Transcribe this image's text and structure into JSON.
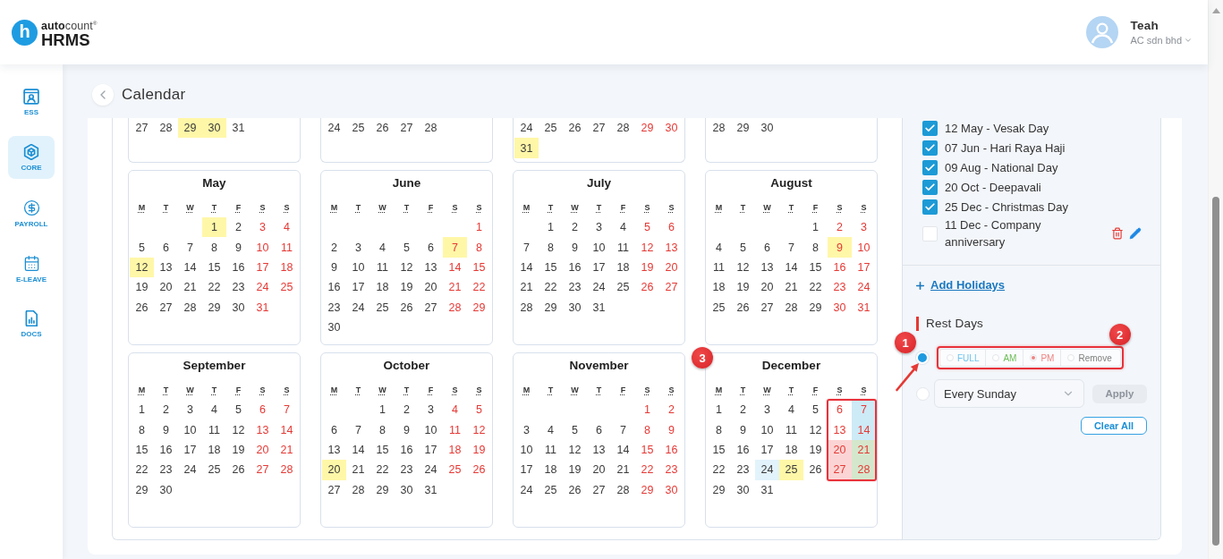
{
  "header": {
    "logo": {
      "mark": "h",
      "brand": "**auto**count$^{®}$",
      "product": "HRMS"
    },
    "user": {
      "name": "Teah",
      "company": "AC sdn bhd"
    }
  },
  "sidebar": {
    "items": [
      {
        "label": "ESS",
        "selected": false
      },
      {
        "label": "CORE",
        "selected": true
      },
      {
        "label": "PAYROLL",
        "selected": false
      },
      {
        "label": "E-LEAVE",
        "selected": false
      },
      {
        "label": "DOCS",
        "selected": false
      }
    ]
  },
  "page": {
    "title": "Calendar"
  },
  "calendar": {
    "months": [
      {
        "weeks": [
          [
            {
              "day": "27",
              "weekend": false
            },
            {
              "day": "28",
              "weekend": false
            },
            {
              "day": "29",
              "weekend": false,
              "color": "#fff7a8"
            },
            {
              "day": "30",
              "weekend": false,
              "color": "#fff7a8"
            },
            {
              "day": "31",
              "weekend": false
            }
          ]
        ]
      },
      {
        "weeks": [
          [
            {
              "day": "24",
              "weekend": false
            },
            {
              "day": "25",
              "weekend": false
            },
            {
              "day": "26",
              "weekend": false
            },
            {
              "day": "27",
              "weekend": false
            },
            {
              "day": "28",
              "weekend": false
            }
          ]
        ]
      },
      {
        "weeks": [
          [
            {
              "day": "24",
              "weekend": false
            },
            {
              "day": "25",
              "weekend": false
            },
            {
              "day": "26",
              "weekend": false
            },
            {
              "day": "27",
              "weekend": false
            },
            {
              "day": "28",
              "weekend": false
            },
            {
              "day": "29",
              "weekend": true
            },
            {
              "day": "30",
              "weekend": true
            }
          ],
          [
            {
              "day": "31",
              "weekend": false,
              "color": "#fff7a8"
            }
          ]
        ]
      },
      {
        "weeks": [
          [
            {
              "day": "28",
              "weekend": false
            },
            {
              "day": "29",
              "weekend": false
            },
            {
              "day": "30",
              "weekend": false
            }
          ]
        ]
      },
      {
        "name": "May",
        "weekdays": [
          "M",
          "T",
          "W",
          "T",
          "F",
          "S",
          "S"
        ],
        "weeks": [
          [
            {
              "day": "1",
              "weekend": false,
              "color": "#fff7a8"
            },
            {
              "day": "2",
              "weekend": false
            },
            {
              "day": "3",
              "weekend": true
            },
            {
              "day": "4",
              "weekend": true
            }
          ],
          [
            {
              "day": "5",
              "weekend": false
            },
            {
              "day": "6",
              "weekend": false
            },
            {
              "day": "7",
              "weekend": false
            },
            {
              "day": "8",
              "weekend": false
            },
            {
              "day": "9",
              "weekend": false
            },
            {
              "day": "10",
              "weekend": true
            },
            {
              "day": "11",
              "weekend": true
            }
          ],
          [
            {
              "day": "12",
              "weekend": false,
              "color": "#fff7a8"
            },
            {
              "day": "13",
              "weekend": false
            },
            {
              "day": "14",
              "weekend": false
            },
            {
              "day": "15",
              "weekend": false
            },
            {
              "day": "16",
              "weekend": false
            },
            {
              "day": "17",
              "weekend": true
            },
            {
              "day": "18",
              "weekend": true
            }
          ],
          [
            {
              "day": "19",
              "weekend": false
            },
            {
              "day": "20",
              "weekend": false
            },
            {
              "day": "21",
              "weekend": false
            },
            {
              "day": "22",
              "weekend": false
            },
            {
              "day": "23",
              "weekend": false
            },
            {
              "day": "24",
              "weekend": true
            },
            {
              "day": "25",
              "weekend": true
            }
          ],
          [
            {
              "day": "26",
              "weekend": false
            },
            {
              "day": "27",
              "weekend": false
            },
            {
              "day": "28",
              "weekend": false
            },
            {
              "day": "29",
              "weekend": false
            },
            {
              "day": "30",
              "weekend": false
            },
            {
              "day": "31",
              "weekend": true
            }
          ]
        ]
      },
      {
        "name": "June",
        "weekdays": [
          "M",
          "T",
          "W",
          "T",
          "F",
          "S",
          "S"
        ],
        "weeks": [
          [
            {
              "day": "1",
              "weekend": true
            }
          ],
          [
            {
              "day": "2",
              "weekend": false
            },
            {
              "day": "3",
              "weekend": false
            },
            {
              "day": "4",
              "weekend": false
            },
            {
              "day": "5",
              "weekend": false
            },
            {
              "day": "6",
              "weekend": false
            },
            {
              "day": "7",
              "weekend": true,
              "color": "#fff7a8"
            },
            {
              "day": "8",
              "weekend": true
            }
          ],
          [
            {
              "day": "9",
              "weekend": false
            },
            {
              "day": "10",
              "weekend": false
            },
            {
              "day": "11",
              "weekend": false
            },
            {
              "day": "12",
              "weekend": false
            },
            {
              "day": "13",
              "weekend": false
            },
            {
              "day": "14",
              "weekend": true
            },
            {
              "day": "15",
              "weekend": true
            }
          ],
          [
            {
              "day": "16",
              "weekend": false
            },
            {
              "day": "17",
              "weekend": false
            },
            {
              "day": "18",
              "weekend": false
            },
            {
              "day": "19",
              "weekend": false
            },
            {
              "day": "20",
              "weekend": false
            },
            {
              "day": "21",
              "weekend": true
            },
            {
              "day": "22",
              "weekend": true
            }
          ],
          [
            {
              "day": "23",
              "weekend": false
            },
            {
              "day": "24",
              "weekend": false
            },
            {
              "day": "25",
              "weekend": false
            },
            {
              "day": "26",
              "weekend": false
            },
            {
              "day": "27",
              "weekend": false
            },
            {
              "day": "28",
              "weekend": true
            },
            {
              "day": "29",
              "weekend": true
            }
          ],
          [
            {
              "day": "30",
              "weekend": false
            }
          ]
        ]
      },
      {
        "name": "July",
        "weekdays": [
          "M",
          "T",
          "W",
          "T",
          "F",
          "S",
          "S"
        ],
        "weeks": [
          [
            {
              "day": "1",
              "weekend": false
            },
            {
              "day": "2",
              "weekend": false
            },
            {
              "day": "3",
              "weekend": false
            },
            {
              "day": "4",
              "weekend": false
            },
            {
              "day": "5",
              "weekend": true
            },
            {
              "day": "6",
              "weekend": true
            }
          ],
          [
            {
              "day": "7",
              "weekend": false
            },
            {
              "day": "8",
              "weekend": false
            },
            {
              "day": "9",
              "weekend": false
            },
            {
              "day": "10",
              "weekend": false
            },
            {
              "day": "11",
              "weekend": false
            },
            {
              "day": "12",
              "weekend": true
            },
            {
              "day": "13",
              "weekend": true
            }
          ],
          [
            {
              "day": "14",
              "weekend": false
            },
            {
              "day": "15",
              "weekend": false
            },
            {
              "day": "16",
              "weekend": false
            },
            {
              "day": "17",
              "weekend": false
            },
            {
              "day": "18",
              "weekend": false
            },
            {
              "day": "19",
              "weekend": true
            },
            {
              "day": "20",
              "weekend": true
            }
          ],
          [
            {
              "day": "21",
              "weekend": false
            },
            {
              "day": "22",
              "weekend": false
            },
            {
              "day": "23",
              "weekend": false
            },
            {
              "day": "24",
              "weekend": false
            },
            {
              "day": "25",
              "weekend": false
            },
            {
              "day": "26",
              "weekend": true
            },
            {
              "day": "27",
              "weekend": true
            }
          ],
          [
            {
              "day": "28",
              "weekend": false
            },
            {
              "day": "29",
              "weekend": false
            },
            {
              "day": "30",
              "weekend": false
            },
            {
              "day": "31",
              "weekend": false
            }
          ]
        ]
      },
      {
        "name": "August",
        "weekdays": [
          "M",
          "T",
          "W",
          "T",
          "F",
          "S",
          "S"
        ],
        "weeks": [
          [
            {
              "day": "1",
              "weekend": false
            },
            {
              "day": "2",
              "weekend": true
            },
            {
              "day": "3",
              "weekend": true
            }
          ],
          [
            {
              "day": "4",
              "weekend": false
            },
            {
              "day": "5",
              "weekend": false
            },
            {
              "day": "6",
              "weekend": false
            },
            {
              "day": "7",
              "weekend": false
            },
            {
              "day": "8",
              "weekend": false
            },
            {
              "day": "9",
              "weekend": true,
              "color": "#fff7a8"
            },
            {
              "day": "10",
              "weekend": true
            }
          ],
          [
            {
              "day": "11",
              "weekend": false
            },
            {
              "day": "12",
              "weekend": false
            },
            {
              "day": "13",
              "weekend": false
            },
            {
              "day": "14",
              "weekend": false
            },
            {
              "day": "15",
              "weekend": false
            },
            {
              "day": "16",
              "weekend": true
            },
            {
              "day": "17",
              "weekend": true
            }
          ],
          [
            {
              "day": "18",
              "weekend": false
            },
            {
              "day": "19",
              "weekend": false
            },
            {
              "day": "20",
              "weekend": false
            },
            {
              "day": "21",
              "weekend": false
            },
            {
              "day": "22",
              "weekend": false
            },
            {
              "day": "23",
              "weekend": true
            },
            {
              "day": "24",
              "weekend": true
            }
          ],
          [
            {
              "day": "25",
              "weekend": false
            },
            {
              "day": "26",
              "weekend": false
            },
            {
              "day": "27",
              "weekend": false
            },
            {
              "day": "28",
              "weekend": false
            },
            {
              "day": "29",
              "weekend": false
            },
            {
              "day": "30",
              "weekend": true
            },
            {
              "day": "31",
              "weekend": true
            }
          ]
        ]
      },
      {
        "name": "September",
        "weekdays": [
          "M",
          "T",
          "W",
          "T",
          "F",
          "S",
          "S"
        ],
        "weeks": [
          [
            {
              "day": "1",
              "weekend": false
            },
            {
              "day": "2",
              "weekend": false
            },
            {
              "day": "3",
              "weekend": false
            },
            {
              "day": "4",
              "weekend": false
            },
            {
              "day": "5",
              "weekend": false
            },
            {
              "day": "6",
              "weekend": true
            },
            {
              "day": "7",
              "weekend": true
            }
          ],
          [
            {
              "day": "8",
              "weekend": false
            },
            {
              "day": "9",
              "weekend": false
            },
            {
              "day": "10",
              "weekend": false
            },
            {
              "day": "11",
              "weekend": false
            },
            {
              "day": "12",
              "weekend": false
            },
            {
              "day": "13",
              "weekend": true
            },
            {
              "day": "14",
              "weekend": true
            }
          ],
          [
            {
              "day": "15",
              "weekend": false
            },
            {
              "day": "16",
              "weekend": false
            },
            {
              "day": "17",
              "weekend": false
            },
            {
              "day": "18",
              "weekend": false
            },
            {
              "day": "19",
              "weekend": false
            },
            {
              "day": "20",
              "weekend": true
            },
            {
              "day": "21",
              "weekend": true
            }
          ],
          [
            {
              "day": "22",
              "weekend": false
            },
            {
              "day": "23",
              "weekend": false
            },
            {
              "day": "24",
              "weekend": false
            },
            {
              "day": "25",
              "weekend": false
            },
            {
              "day": "26",
              "weekend": false
            },
            {
              "day": "27",
              "weekend": true
            },
            {
              "day": "28",
              "weekend": true
            }
          ],
          [
            {
              "day": "29",
              "weekend": false
            },
            {
              "day": "30",
              "weekend": false
            }
          ]
        ]
      },
      {
        "name": "October",
        "weekdays": [
          "M",
          "T",
          "W",
          "T",
          "F",
          "S",
          "S"
        ],
        "weeks": [
          [
            {
              "day": "1",
              "weekend": false
            },
            {
              "day": "2",
              "weekend": false
            },
            {
              "day": "3",
              "weekend": false
            },
            {
              "day": "4",
              "weekend": true
            },
            {
              "day": "5",
              "weekend": true
            }
          ],
          [
            {
              "day": "6",
              "weekend": false
            },
            {
              "day": "7",
              "weekend": false
            },
            {
              "day": "8",
              "weekend": false
            },
            {
              "day": "9",
              "weekend": false
            },
            {
              "day": "10",
              "weekend": false
            },
            {
              "day": "11",
              "weekend": true
            },
            {
              "day": "12",
              "weekend": true
            }
          ],
          [
            {
              "day": "13",
              "weekend": false
            },
            {
              "day": "14",
              "weekend": false
            },
            {
              "day": "15",
              "weekend": false
            },
            {
              "day": "16",
              "weekend": false
            },
            {
              "day": "17",
              "weekend": false
            },
            {
              "day": "18",
              "weekend": true
            },
            {
              "day": "19",
              "weekend": true
            }
          ],
          [
            {
              "day": "20",
              "weekend": false,
              "color": "#fff7a8"
            },
            {
              "day": "21",
              "weekend": false
            },
            {
              "day": "22",
              "weekend": false
            },
            {
              "day": "23",
              "weekend": false
            },
            {
              "day": "24",
              "weekend": false
            },
            {
              "day": "25",
              "weekend": true
            },
            {
              "day": "26",
              "weekend": true
            }
          ],
          [
            {
              "day": "27",
              "weekend": false
            },
            {
              "day": "28",
              "weekend": false
            },
            {
              "day": "29",
              "weekend": false
            },
            {
              "day": "30",
              "weekend": false
            },
            {
              "day": "31",
              "weekend": false
            }
          ]
        ]
      },
      {
        "name": "November",
        "weekdays": [
          "M",
          "T",
          "W",
          "T",
          "F",
          "S",
          "S"
        ],
        "weeks": [
          [
            {
              "day": "1",
              "weekend": true
            },
            {
              "day": "2",
              "weekend": true
            }
          ],
          [
            {
              "day": "3",
              "weekend": false
            },
            {
              "day": "4",
              "weekend": false
            },
            {
              "day": "5",
              "weekend": false
            },
            {
              "day": "6",
              "weekend": false
            },
            {
              "day": "7",
              "weekend": false
            },
            {
              "day": "8",
              "weekend": true
            },
            {
              "day": "9",
              "weekend": true
            }
          ],
          [
            {
              "day": "10",
              "weekend": false
            },
            {
              "day": "11",
              "weekend": false
            },
            {
              "day": "12",
              "weekend": false
            },
            {
              "day": "13",
              "weekend": false
            },
            {
              "day": "14",
              "weekend": false
            },
            {
              "day": "15",
              "weekend": true
            },
            {
              "day": "16",
              "weekend": true
            }
          ],
          [
            {
              "day": "17",
              "weekend": false
            },
            {
              "day": "18",
              "weekend": false
            },
            {
              "day": "19",
              "weekend": false
            },
            {
              "day": "20",
              "weekend": false
            },
            {
              "day": "21",
              "weekend": false
            },
            {
              "day": "22",
              "weekend": true
            },
            {
              "day": "23",
              "weekend": true
            }
          ],
          [
            {
              "day": "24",
              "weekend": false
            },
            {
              "day": "25",
              "weekend": false
            },
            {
              "day": "26",
              "weekend": false
            },
            {
              "day": "27",
              "weekend": false
            },
            {
              "day": "28",
              "weekend": false
            },
            {
              "day": "29",
              "weekend": true
            },
            {
              "day": "30",
              "weekend": true
            }
          ]
        ]
      },
      {
        "name": "December",
        "annotation": {
          "label": "3"
        },
        "weekend_framed": true,
        "weekdays": [
          "M",
          "T",
          "W",
          "T",
          "F",
          "S",
          "S"
        ],
        "weeks": [
          [
            {
              "day": "1",
              "weekend": false
            },
            {
              "day": "2",
              "weekend": false
            },
            {
              "day": "3",
              "weekend": false
            },
            {
              "day": "4",
              "weekend": false
            },
            {
              "day": "5",
              "weekend": false
            },
            {
              "day": "6",
              "weekend": true
            },
            {
              "day": "7",
              "weekend": true,
              "color": "#cdeaf7"
            }
          ],
          [
            {
              "day": "8",
              "weekend": false
            },
            {
              "day": "9",
              "weekend": false
            },
            {
              "day": "10",
              "weekend": false
            },
            {
              "day": "11",
              "weekend": false
            },
            {
              "day": "12",
              "weekend": false
            },
            {
              "day": "13",
              "weekend": true
            },
            {
              "day": "14",
              "weekend": true,
              "color": "#cdeaf7"
            }
          ],
          [
            {
              "day": "15",
              "weekend": false
            },
            {
              "day": "16",
              "weekend": false
            },
            {
              "day": "17",
              "weekend": false
            },
            {
              "day": "18",
              "weekend": false
            },
            {
              "day": "19",
              "weekend": false
            },
            {
              "day": "20",
              "weekend": true,
              "color": "#fbd5d5"
            },
            {
              "day": "21",
              "weekend": true,
              "color": "#d4e7cc"
            }
          ],
          [
            {
              "day": "22",
              "weekend": false
            },
            {
              "day": "23",
              "weekend": false
            },
            {
              "day": "24",
              "weekend": false,
              "color": "#e2f3fb"
            },
            {
              "day": "25",
              "weekend": false,
              "color": "#fff7a8"
            },
            {
              "day": "26",
              "weekend": false
            },
            {
              "day": "27",
              "weekend": true,
              "color": "#fbd5d5"
            },
            {
              "day": "28",
              "weekend": true,
              "color": "#d4e7cc"
            }
          ],
          [
            {
              "day": "29",
              "weekend": false
            },
            {
              "day": "30",
              "weekend": false
            },
            {
              "day": "31",
              "weekend": false
            }
          ]
        ]
      }
    ]
  },
  "holidays": {
    "items": [
      {
        "label": "12 May - Vesak Day",
        "checked": true,
        "editable": false
      },
      {
        "label": "07 Jun - Hari Raya Haji",
        "checked": true,
        "editable": false
      },
      {
        "label": "09 Aug - National Day",
        "checked": true,
        "editable": false
      },
      {
        "label": "20 Oct - Deepavali",
        "checked": true,
        "editable": false
      },
      {
        "label": "25 Dec - Christmas Day",
        "checked": true,
        "editable": false
      },
      {
        "label": "11 Dec - Company anniversary",
        "checked": false,
        "editable": true
      }
    ],
    "add_link": "Add Holidays"
  },
  "rest_days": {
    "title": "Rest Days",
    "modes": [
      {
        "kind": "portion",
        "selected": true,
        "annotation": {
          "label": "1",
          "arrow": true
        },
        "options": {
          "framed": true,
          "annotation": {
            "label": "2"
          },
          "items": [
            {
              "label": "FULL",
              "kind": "full",
              "selected": false
            },
            {
              "label": "AM",
              "kind": "am",
              "selected": false
            },
            {
              "label": "PM",
              "kind": "pm",
              "selected": true
            },
            {
              "label": "Remove",
              "kind": "remove",
              "selected": false
            }
          ]
        }
      },
      {
        "kind": "repeat",
        "selected": false,
        "value": "Every Sunday",
        "apply": {
          "label": "Apply",
          "disabled": true
        }
      }
    ],
    "clear_all": "Clear All"
  }
}
